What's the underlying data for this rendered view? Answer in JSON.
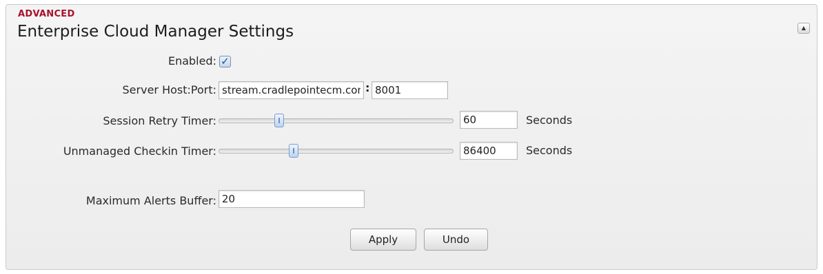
{
  "panel": {
    "section_label": "ADVANCED",
    "title": "Enterprise Cloud Manager Settings",
    "collapse_icon": "collapse-up-icon"
  },
  "form": {
    "enabled": {
      "label": "Enabled:",
      "checked": true
    },
    "server": {
      "label": "Server Host:Port:",
      "host": "stream.cradlepointecm.com",
      "port": "8001"
    },
    "session_retry": {
      "label": "Session Retry Timer:",
      "value": "60",
      "unit": "Seconds",
      "slider_level": 0.23
    },
    "unmanaged_checkin": {
      "label": "Unmanaged Checkin Timer:",
      "value": "86400",
      "unit": "Seconds",
      "slider_level": 0.29
    },
    "max_alerts": {
      "label": "Maximum Alerts Buffer:",
      "value": "20"
    }
  },
  "buttons": {
    "apply": "Apply",
    "undo": "Undo"
  }
}
